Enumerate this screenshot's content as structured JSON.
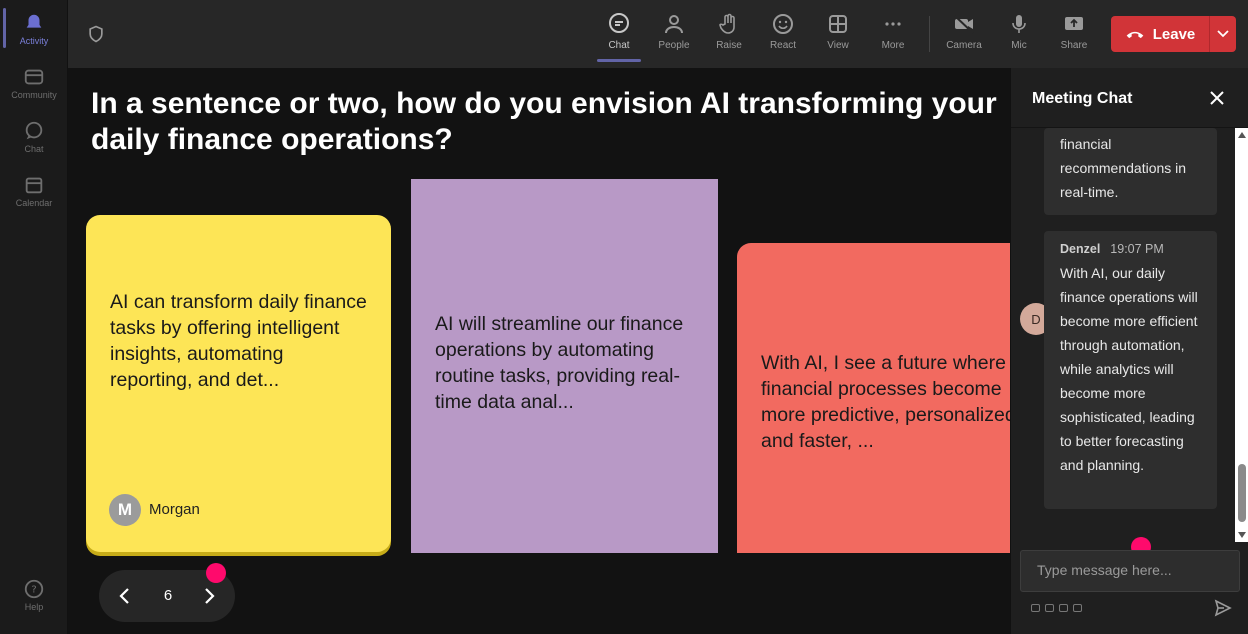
{
  "rail": {
    "items": [
      {
        "label": "Activity",
        "icon": "bell-icon"
      },
      {
        "label": "Community",
        "icon": "community-icon"
      },
      {
        "label": "Chat",
        "icon": "chat-icon"
      },
      {
        "label": "Calendar",
        "icon": "calendar-icon"
      }
    ],
    "help": {
      "label": "Help",
      "icon": "help-icon"
    }
  },
  "toolbar": {
    "buttons": [
      {
        "label": "Chat",
        "icon": "chat-icon",
        "active": true
      },
      {
        "label": "People",
        "icon": "people-icon"
      },
      {
        "label": "Raise",
        "icon": "hand-icon"
      },
      {
        "label": "React",
        "icon": "smiley-icon"
      },
      {
        "label": "View",
        "icon": "grid-icon"
      },
      {
        "label": "More",
        "icon": "more-icon"
      },
      {
        "label": "Camera",
        "icon": "camera-off-icon"
      },
      {
        "label": "Mic",
        "icon": "mic-icon"
      },
      {
        "label": "Share",
        "icon": "share-icon"
      }
    ],
    "leave_label": "Leave",
    "leave_color": "#d13438"
  },
  "stage": {
    "question": "In a sentence or two, how do you envision AI transforming your daily finance operations?",
    "notes": [
      {
        "text": "AI can transform daily finance tasks by offering intelligent insights, automating reporting, and det...",
        "color": "#fde556",
        "author": "Morgan",
        "author_initial": "M"
      },
      {
        "text": "AI will streamline our finance operations by automating routine tasks, providing real-time data anal...",
        "color": "#b899c6"
      },
      {
        "text": "With AI, I see a future where financial processes become more predictive, personalized, and faster, ...",
        "color": "#f26a60"
      }
    ],
    "pager": {
      "page": "6"
    }
  },
  "chat": {
    "title": "Meeting Chat",
    "prev_message_tail": "financial recommendations in real-time.",
    "message": {
      "sender": "Denzel",
      "initial": "D",
      "time": "19:07 PM",
      "text": "With AI, our daily finance operations will become more efficient through automation, while analytics will become more sophisticated, leading to better forecasting and planning."
    },
    "input_placeholder": "Type message here..."
  },
  "accent_color": "#6264a7"
}
